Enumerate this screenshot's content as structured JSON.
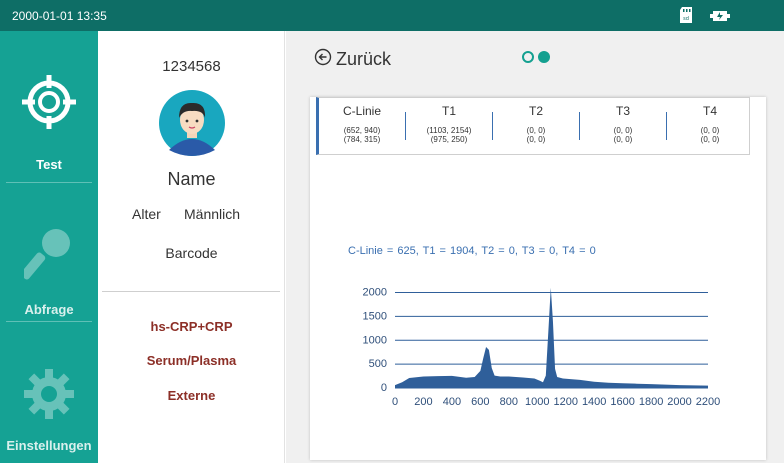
{
  "status": {
    "datetime": "2000-01-01 13:35",
    "icons": [
      "sd-card-icon",
      "battery-icon"
    ]
  },
  "nav": {
    "items": [
      {
        "label": "Test",
        "icon": "crosshair-icon",
        "active": true
      },
      {
        "label": "Abfrage",
        "icon": "search-icon",
        "active": false
      },
      {
        "label": "Einstellungen",
        "icon": "gear-icon",
        "active": false
      }
    ]
  },
  "patient": {
    "id": "1234568",
    "name": "Name",
    "age_label": "Alter",
    "gender": "Männlich",
    "barcode_label": "Barcode",
    "test_item": "hs-CRP+CRP",
    "sample_type": "Serum/Plasma",
    "mode": "Externe"
  },
  "main": {
    "back_label": "Zurück",
    "pager": {
      "pages": 2,
      "current": 2
    }
  },
  "table": {
    "columns": [
      {
        "header": "C-Linie",
        "line1": "(652, 940)",
        "line2": "(784, 315)"
      },
      {
        "header": "T1",
        "line1": "(1103, 2154)",
        "line2": "(975, 250)"
      },
      {
        "header": "T2",
        "line1": "(0, 0)",
        "line2": "(0, 0)"
      },
      {
        "header": "T3",
        "line1": "(0, 0)",
        "line2": "(0, 0)"
      },
      {
        "header": "T4",
        "line1": "(0, 0)",
        "line2": "(0, 0)"
      }
    ]
  },
  "summary": "C-Linie = 625,   T1 = 1904,   T2 = 0,   T3 = 0,   T4 = 0",
  "colors": {
    "primary": "#15a294",
    "statusbar": "#0e6e66",
    "accent_red": "#8c2f27",
    "chart_blue": "#2f5f9a"
  },
  "chart_data": {
    "type": "area",
    "x": [
      0,
      50,
      100,
      200,
      300,
      400,
      500,
      560,
      600,
      620,
      640,
      660,
      680,
      700,
      740,
      800,
      900,
      980,
      1020,
      1040,
      1060,
      1080,
      1095,
      1110,
      1125,
      1140,
      1180,
      1300,
      1400,
      1500,
      1600,
      1700,
      1800,
      1900,
      2000,
      2100,
      2200
    ],
    "values": [
      60,
      120,
      210,
      240,
      250,
      255,
      215,
      230,
      360,
      620,
      860,
      800,
      420,
      260,
      240,
      240,
      220,
      200,
      150,
      120,
      260,
      1300,
      2100,
      1400,
      400,
      230,
      200,
      170,
      130,
      110,
      100,
      90,
      80,
      70,
      60,
      55,
      50
    ],
    "x_ticks": [
      0,
      200,
      400,
      600,
      800,
      1000,
      1200,
      1400,
      1600,
      1800,
      2000,
      2200
    ],
    "y_ticks": [
      0,
      500,
      1000,
      1500,
      2000
    ],
    "xlim": [
      0,
      2200
    ],
    "ylim": [
      0,
      2200
    ],
    "grid": "horizontal"
  }
}
